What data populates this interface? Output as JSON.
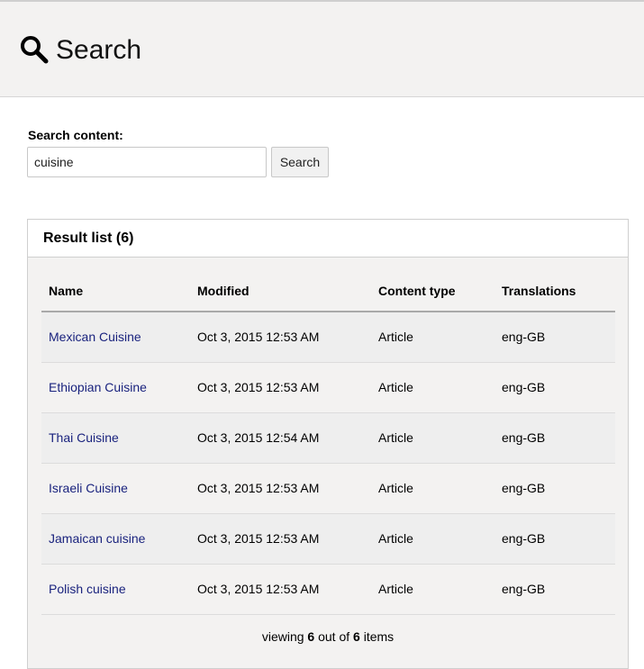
{
  "header": {
    "title": "Search",
    "icon": "search-icon"
  },
  "search": {
    "label": "Search content:",
    "value": "cuisine",
    "button_label": "Search"
  },
  "results": {
    "heading": "Result list (6)",
    "columns": [
      "Name",
      "Modified",
      "Content type",
      "Translations"
    ],
    "rows": [
      {
        "name": "Mexican Cuisine",
        "modified": "Oct 3, 2015 12:53 AM",
        "type": "Article",
        "translations": "eng-GB"
      },
      {
        "name": "Ethiopian Cuisine",
        "modified": "Oct 3, 2015 12:53 AM",
        "type": "Article",
        "translations": "eng-GB"
      },
      {
        "name": "Thai Cuisine",
        "modified": "Oct 3, 2015 12:54 AM",
        "type": "Article",
        "translations": "eng-GB"
      },
      {
        "name": "Israeli Cuisine",
        "modified": "Oct 3, 2015 12:53 AM",
        "type": "Article",
        "translations": "eng-GB"
      },
      {
        "name": "Jamaican cuisine",
        "modified": "Oct 3, 2015 12:53 AM",
        "type": "Article",
        "translations": "eng-GB"
      },
      {
        "name": "Polish cuisine",
        "modified": "Oct 3, 2015 12:53 AM",
        "type": "Article",
        "translations": "eng-GB"
      }
    ],
    "pager": {
      "prefix": "viewing",
      "shown": "6",
      "middle": "out of",
      "total": "6",
      "suffix": "items"
    }
  },
  "colors": {
    "link": "#1a237e",
    "header_bg": "#f3f2f1"
  }
}
